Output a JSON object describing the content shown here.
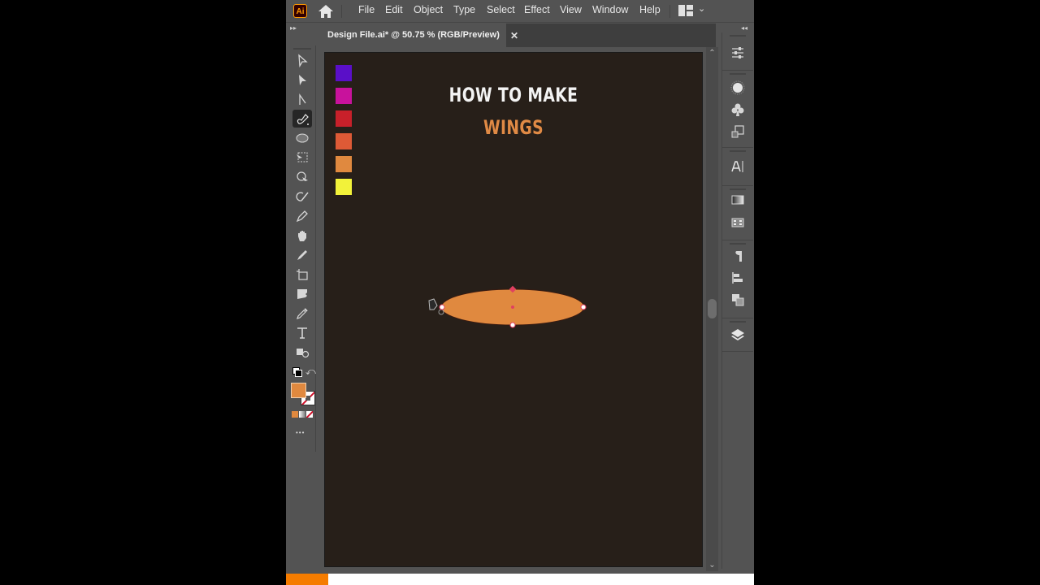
{
  "app": {
    "logo_text": "Ai"
  },
  "menu": {
    "items": [
      "File",
      "Edit",
      "Object",
      "Type",
      "Select",
      "Effect",
      "View",
      "Window",
      "Help"
    ]
  },
  "document_tab": {
    "title": "Design File.ai* @ 50.75 % (RGB/Preview)",
    "close_glyph": "✕"
  },
  "toolbar": {
    "tools": [
      "selection-tool",
      "direct-selection-tool",
      "curvature-anchor-tool",
      "pen-tool",
      "ellipse-tool",
      "free-transform-tool",
      "shape-builder-tool",
      "rotate-tool",
      "pencil-tool",
      "hand-tool",
      "paintbrush-tool",
      "artboard-tool",
      "gradient-tool",
      "eyedropper-tool",
      "type-tool",
      "symbol-sprayer-tool"
    ],
    "active_tool": "pen-tool",
    "fill_color": "#e0893f",
    "stroke": "none",
    "more_glyph": "•••"
  },
  "artboard": {
    "background": "#271f19",
    "swatches": [
      "#5a0fc8",
      "#c8129c",
      "#c8202a",
      "#de5a36",
      "#e0893f",
      "#f2f23a"
    ],
    "title_line1": "HOW TO MAKE",
    "title_line2": "WINGS",
    "title_color": "#f3f3f3",
    "accent_color": "#e08a45",
    "shape": {
      "type": "ellipse",
      "fill": "#e0893f",
      "state": "selected"
    }
  },
  "right_panel": {
    "icons": [
      "properties-icon",
      "appearance-icon",
      "symbols-icon",
      "transform-icon",
      "character-icon",
      "gradient-icon",
      "swatches-icon",
      "paragraph-icon",
      "align-icon",
      "pathfinder-icon",
      "layers-icon"
    ]
  },
  "progress": {
    "percent": 9,
    "color": "#f57c00"
  }
}
